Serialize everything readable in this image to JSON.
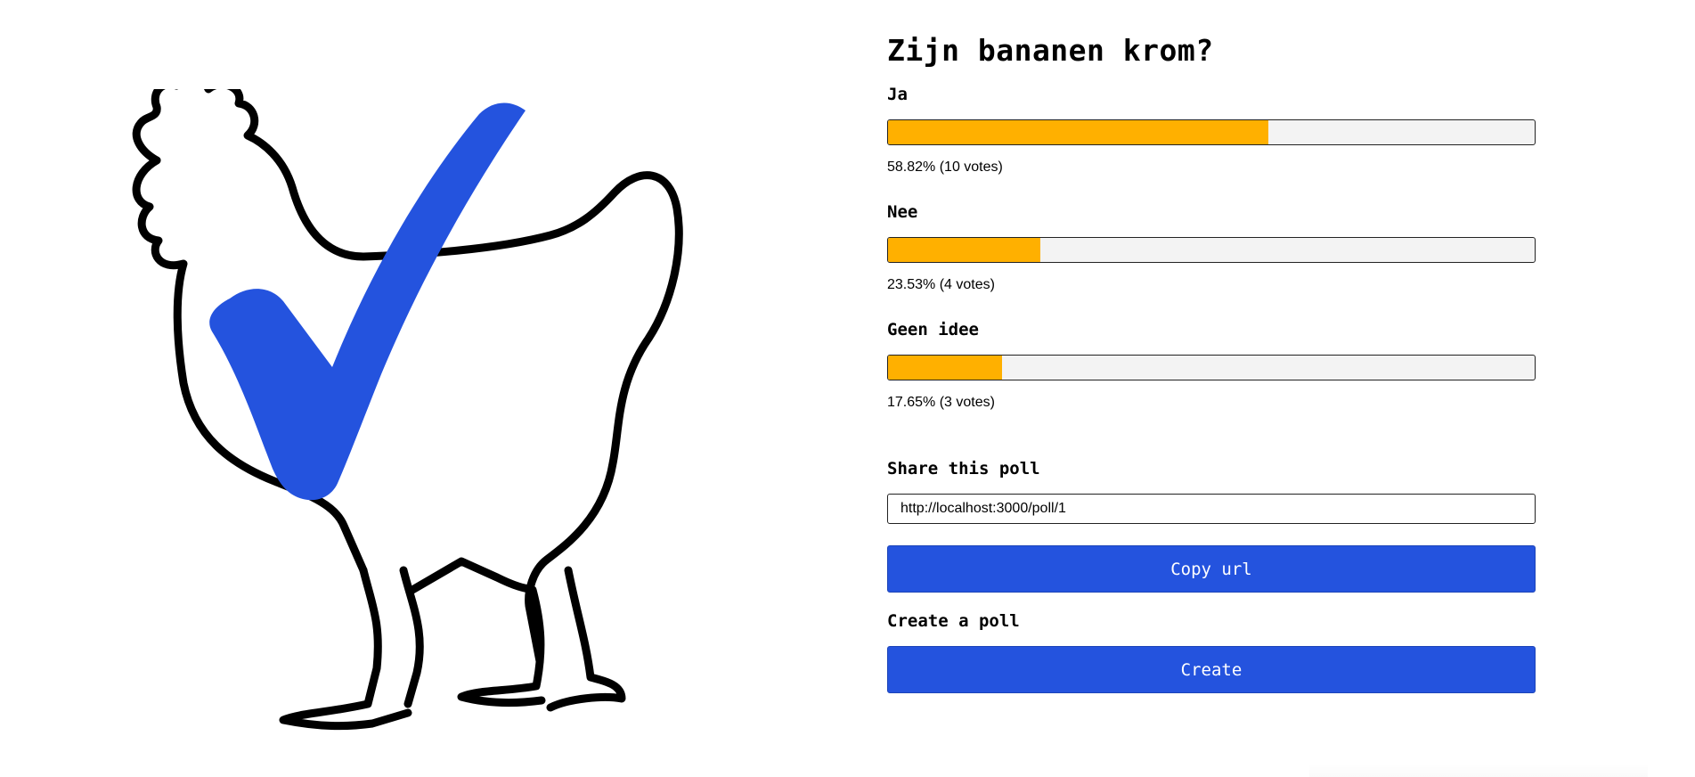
{
  "poll": {
    "question": "Zijn bananen krom?",
    "options": [
      {
        "label": "Ja",
        "percent": 58.82,
        "stats": "58.82% (10 votes)"
      },
      {
        "label": "Nee",
        "percent": 23.53,
        "stats": "23.53% (4 votes)"
      },
      {
        "label": "Geen idee",
        "percent": 17.65,
        "stats": "17.65% (3 votes)"
      }
    ]
  },
  "share": {
    "label": "Share this poll",
    "url": "http://localhost:3000/poll/1",
    "copy_label": "Copy url"
  },
  "create": {
    "label": "Create a poll",
    "button_label": "Create"
  },
  "logo": {
    "icon": "chicken-checkmark-logo"
  },
  "colors": {
    "accent": "#2453de",
    "bar_fill": "#ffb000",
    "bar_track": "#f3f3f3",
    "checkmark": "#2453de"
  }
}
